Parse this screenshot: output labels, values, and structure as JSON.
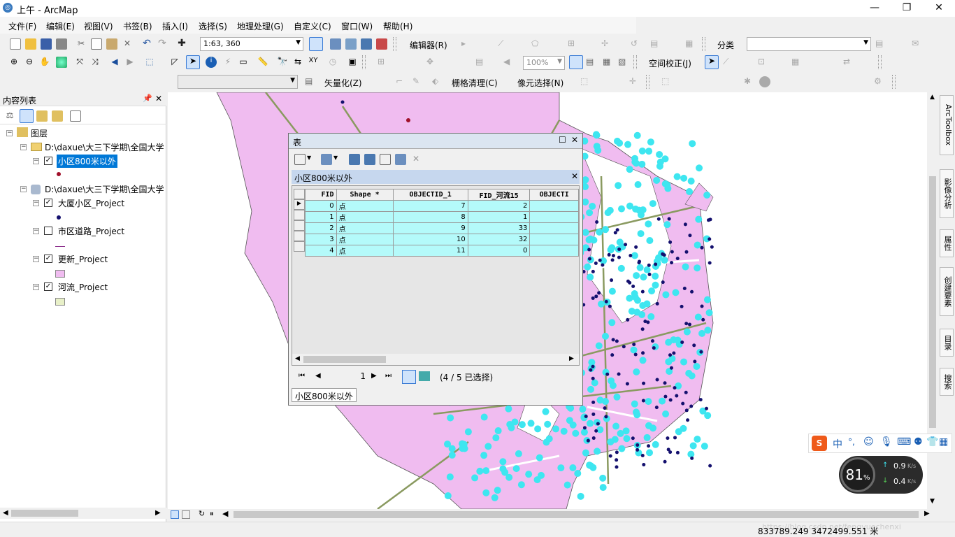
{
  "window": {
    "title": "上午 - ArcMap"
  },
  "menu": [
    "文件(F)",
    "编辑(E)",
    "视图(V)",
    "书签(B)",
    "插入(I)",
    "选择(S)",
    "地理处理(G)",
    "自定义(C)",
    "窗口(W)",
    "帮助(H)"
  ],
  "toolbar": {
    "scale": "1:63, 360",
    "editor": "编辑器(R)",
    "classify": "分类",
    "zoom": "100%",
    "spatial_adjust": "空间校正(J)",
    "vectorize": "矢量化(Z)",
    "raster_clean": "栅格清理(C)",
    "pixel_select": "像元选择(N)"
  },
  "toc": {
    "title": "内容列表",
    "layers_root": "图层",
    "folder1": "D:\\daxue\\大三下学期\\全国大学",
    "layer_selected": "小区800米以外",
    "folder2": "D:\\daxue\\大三下学期\\全国大学",
    "layers": [
      {
        "name": "大厦小区_Project",
        "checked": true
      },
      {
        "name": "市区道路_Project",
        "checked": false
      },
      {
        "name": "更新_Project",
        "checked": true
      },
      {
        "name": "河流_Project",
        "checked": true
      }
    ]
  },
  "table": {
    "window_title": "表",
    "tab_title": "小区800米以外",
    "columns": [
      "FID",
      "Shape *",
      "OBJECTID_1",
      "FID_河流15",
      "OBJECTI"
    ],
    "rows": [
      [
        "0",
        "点",
        "7",
        "2",
        ""
      ],
      [
        "1",
        "点",
        "8",
        "1",
        ""
      ],
      [
        "2",
        "点",
        "9",
        "33",
        ""
      ],
      [
        "3",
        "点",
        "10",
        "32",
        ""
      ],
      [
        "4",
        "点",
        "11",
        "0",
        ""
      ]
    ],
    "current_record": "1",
    "selection_status": "(4 / 5 已选择)",
    "bottom_tab": "小区800米以外"
  },
  "right_tabs": [
    "ArcToolbox",
    "影像分析",
    "属性",
    "创建要素",
    "目录",
    "搜索"
  ],
  "status": {
    "coords": "833789.249  3472499.551 米",
    "watermark": "https://blog.csdn.net/fengyuechenxi"
  },
  "net_widget": {
    "percent": "81",
    "pct_sign": "%",
    "up": "0.9",
    "down": "0.4",
    "unit": "K/s"
  },
  "ime": {
    "lang": "中"
  },
  "colors": {
    "accent": "#0078d7",
    "parcel": "#f0bcf0",
    "point_cyan": "#3ee6f0",
    "point_navy": "#14106e",
    "table_row": "#b4fafa"
  }
}
